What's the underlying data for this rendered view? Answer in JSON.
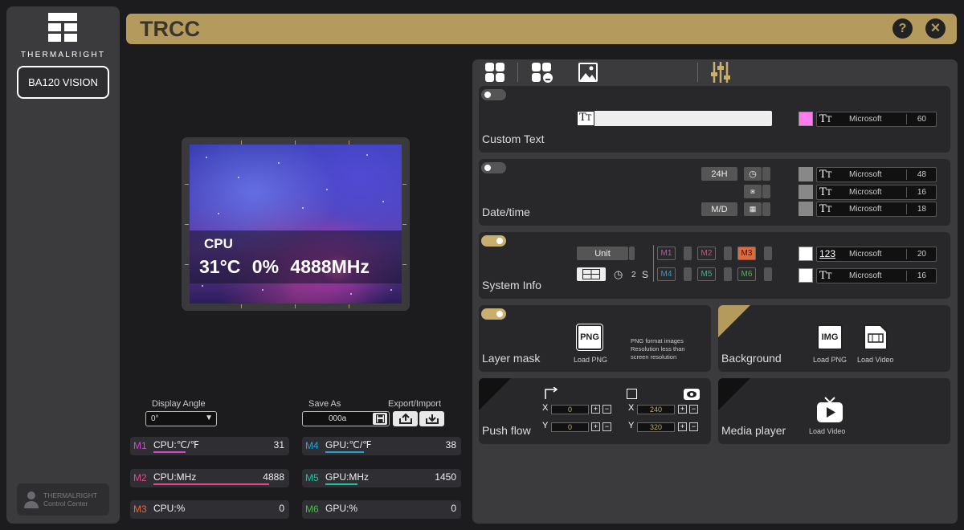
{
  "sidebar": {
    "logo_text": "THERMALRIGHT",
    "device": "BA120 VISION",
    "badge_line1": "THERMALRIGHT",
    "badge_line2": "Control Center"
  },
  "titlebar": {
    "title": "TRCC",
    "help": "?",
    "close": "×"
  },
  "preview": {
    "label": "CPU",
    "values": "31°C 0% 4888MHz"
  },
  "display_angle": {
    "label": "Display Angle",
    "value": "0°"
  },
  "save_as": {
    "label": "Save As",
    "value": "000a"
  },
  "export_import": {
    "label": "Export/Import"
  },
  "metrics": [
    {
      "tag": "M1",
      "name": "CPU:℃/℉",
      "value": "31",
      "color": "#d048d0",
      "fill": 0.25
    },
    {
      "tag": "M2",
      "name": "CPU:MHz",
      "value": "4888",
      "color": "#e04a8a",
      "fill": 0.9
    },
    {
      "tag": "M3",
      "name": "CPU:%",
      "value": "0",
      "color": "#e06a40",
      "fill": 0
    },
    {
      "tag": "M4",
      "name": "GPU:℃/℉",
      "value": "38",
      "color": "#2a9fd6",
      "fill": 0.3
    },
    {
      "tag": "M5",
      "name": "GPU:MHz",
      "value": "1450",
      "color": "#20c0a0",
      "fill": 0.25
    },
    {
      "tag": "M6",
      "name": "GPU:%",
      "value": "0",
      "color": "#40c040",
      "fill": 0
    }
  ],
  "custom_text": {
    "title": "Custom Text",
    "font": "Microsoft",
    "size": "60",
    "color": "#ff7cf0"
  },
  "datetime": {
    "title": "Date/time",
    "time_format": "24H",
    "date_format": "M/D",
    "rows": [
      {
        "font": "Microsoft",
        "size": "48"
      },
      {
        "font": "Microsoft",
        "size": "16"
      },
      {
        "font": "Microsoft",
        "size": "18"
      }
    ]
  },
  "system_info": {
    "title": "System Info",
    "unit": "Unit",
    "interval": "2",
    "interval_unit": "S",
    "chips": [
      "M1",
      "M2",
      "M3",
      "M4",
      "M5",
      "M6"
    ],
    "rows": [
      {
        "icon_text": "123",
        "font": "Microsoft",
        "size": "20"
      },
      {
        "font": "Microsoft",
        "size": "16"
      }
    ]
  },
  "layer_mask": {
    "title": "Layer mask",
    "png": "PNG",
    "load": "Load PNG",
    "note": "PNG format images Resolution less than screen resolution"
  },
  "background": {
    "title": "Background",
    "img": "IMG",
    "load_png": "Load PNG",
    "load_video": "Load Video"
  },
  "push_flow": {
    "title": "Push flow",
    "x_label": "X",
    "y_label": "Y",
    "x1": "0",
    "y1": "0",
    "x2": "240",
    "y2": "320"
  },
  "media_player": {
    "title": "Media player",
    "load_video": "Load Video"
  },
  "colors": {
    "gold": "#b49a5c",
    "toggle_on": "#c9ae6e",
    "toggle_off": "#555"
  }
}
